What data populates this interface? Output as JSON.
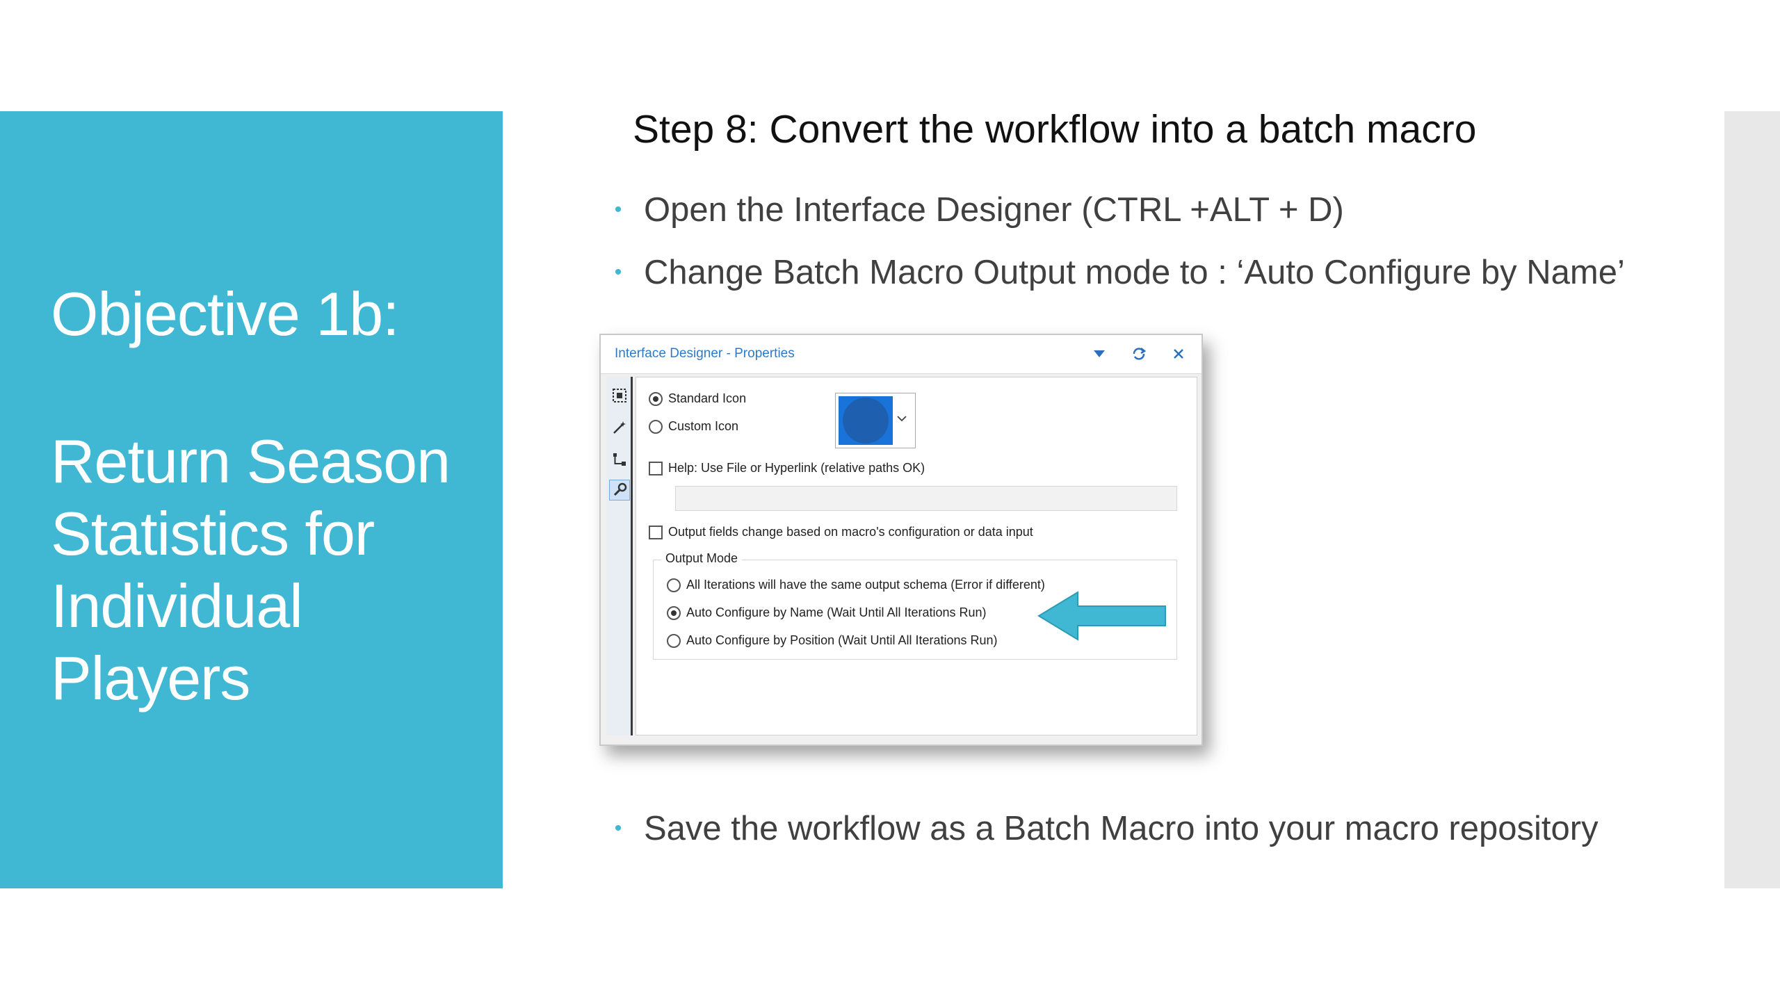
{
  "left": {
    "title": "Objective 1b:",
    "subtitle": "Return Season Statistics for Individual Players"
  },
  "slide": {
    "step_title": "Step 8: Convert the workflow into a batch macro",
    "bullets": [
      "Open the Interface Designer (CTRL +ALT + D)",
      "Change Batch Macro Output mode to : ‘Auto Configure by Name’",
      "Save the workflow as a Batch Macro into your macro repository"
    ],
    "bullet_glyph": "•"
  },
  "dialog": {
    "title": "Interface Designer - Properties",
    "standard_icon": "Standard Icon",
    "custom_icon": "Custom Icon",
    "help_label": "Help: Use File or Hyperlink (relative paths OK)",
    "output_fields_label": "Output fields change based on macro's configuration or data input",
    "output_mode_label": "Output Mode",
    "output_modes": [
      "All Iterations will have the same output schema (Error if different)",
      "Auto Configure by Name (Wait Until All Iterations Run)",
      "Auto Configure by Position (Wait Until All Iterations Run)"
    ],
    "selected_output_mode": 1,
    "icon_color": "#1a73d9"
  },
  "colors": {
    "accent": "#40b8d3",
    "dialog_title": "#2b7bc9"
  }
}
